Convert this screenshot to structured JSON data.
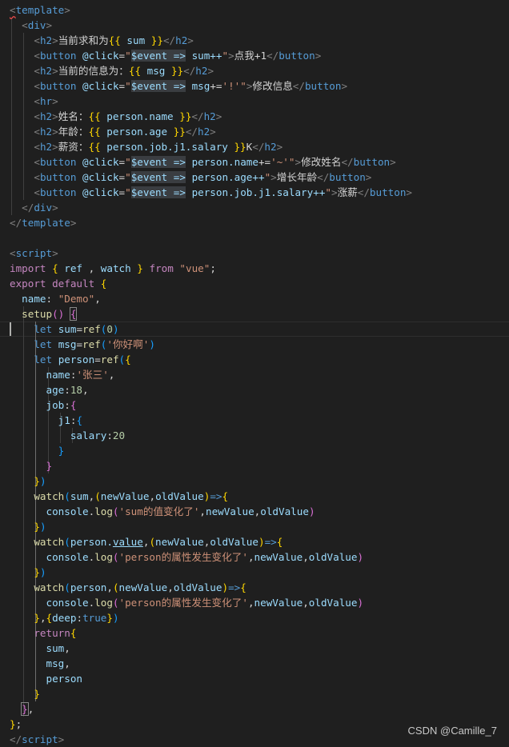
{
  "code_lines": [
    [
      [
        "template-angle",
        "<"
      ],
      [
        "tag",
        "template"
      ],
      [
        "angle",
        ">"
      ]
    ],
    [
      [
        "plain",
        "  "
      ],
      [
        "angle",
        "<"
      ],
      [
        "tag",
        "div"
      ],
      [
        "angle",
        ">"
      ]
    ],
    [
      [
        "plain",
        "    "
      ],
      [
        "angle",
        "<"
      ],
      [
        "tag",
        "h2"
      ],
      [
        "angle",
        ">"
      ],
      [
        "text",
        "当前求和为"
      ],
      [
        "brace",
        "{{"
      ],
      [
        "var",
        " sum "
      ],
      [
        "brace",
        "}}"
      ],
      [
        "angle",
        "</"
      ],
      [
        "tag",
        "h2"
      ],
      [
        "angle",
        ">"
      ]
    ],
    [
      [
        "plain",
        "    "
      ],
      [
        "angle",
        "<"
      ],
      [
        "tag",
        "button"
      ],
      [
        "plain",
        " "
      ],
      [
        "attr",
        "@click"
      ],
      [
        "plain",
        "="
      ],
      [
        "str",
        "\""
      ],
      [
        "hlvar",
        "$event =>"
      ],
      [
        "plain",
        " "
      ],
      [
        "var",
        "sum++"
      ],
      [
        "str",
        "\""
      ],
      [
        "angle",
        ">"
      ],
      [
        "text",
        "点我+1"
      ],
      [
        "angle",
        "</"
      ],
      [
        "tag",
        "button"
      ],
      [
        "angle",
        ">"
      ]
    ],
    [
      [
        "plain",
        "    "
      ],
      [
        "angle",
        "<"
      ],
      [
        "tag",
        "h2"
      ],
      [
        "angle",
        ">"
      ],
      [
        "text",
        "当前的信息为："
      ],
      [
        "brace",
        "{{"
      ],
      [
        "var",
        " msg "
      ],
      [
        "brace",
        "}}"
      ],
      [
        "angle",
        "</"
      ],
      [
        "tag",
        "h2"
      ],
      [
        "angle",
        ">"
      ]
    ],
    [
      [
        "plain",
        "    "
      ],
      [
        "angle",
        "<"
      ],
      [
        "tag",
        "button"
      ],
      [
        "plain",
        " "
      ],
      [
        "attr",
        "@click"
      ],
      [
        "plain",
        "="
      ],
      [
        "str",
        "\""
      ],
      [
        "hlvar",
        "$event =>"
      ],
      [
        "plain",
        " "
      ],
      [
        "var",
        "msg"
      ],
      [
        "plain",
        "+="
      ],
      [
        "str",
        "'!'"
      ],
      [
        "str",
        "\""
      ],
      [
        "angle",
        ">"
      ],
      [
        "text",
        "修改信息"
      ],
      [
        "angle",
        "</"
      ],
      [
        "tag",
        "button"
      ],
      [
        "angle",
        ">"
      ]
    ],
    [
      [
        "plain",
        "    "
      ],
      [
        "angle",
        "<"
      ],
      [
        "tag",
        "hr"
      ],
      [
        "angle",
        ">"
      ]
    ],
    [
      [
        "plain",
        "    "
      ],
      [
        "angle",
        "<"
      ],
      [
        "tag",
        "h2"
      ],
      [
        "angle",
        ">"
      ],
      [
        "text",
        "姓名："
      ],
      [
        "brace",
        "{{"
      ],
      [
        "var",
        " person.name "
      ],
      [
        "brace",
        "}}"
      ],
      [
        "angle",
        "</"
      ],
      [
        "tag",
        "h2"
      ],
      [
        "angle",
        ">"
      ]
    ],
    [
      [
        "plain",
        "    "
      ],
      [
        "angle",
        "<"
      ],
      [
        "tag",
        "h2"
      ],
      [
        "angle",
        ">"
      ],
      [
        "text",
        "年龄："
      ],
      [
        "brace",
        "{{"
      ],
      [
        "var",
        " person.age "
      ],
      [
        "brace",
        "}}"
      ],
      [
        "angle",
        "</"
      ],
      [
        "tag",
        "h2"
      ],
      [
        "angle",
        ">"
      ]
    ],
    [
      [
        "plain",
        "    "
      ],
      [
        "angle",
        "<"
      ],
      [
        "tag",
        "h2"
      ],
      [
        "angle",
        ">"
      ],
      [
        "text",
        "薪资："
      ],
      [
        "brace",
        "{{"
      ],
      [
        "var",
        " person.job.j1.salary "
      ],
      [
        "brace",
        "}}"
      ],
      [
        "text",
        "K"
      ],
      [
        "angle",
        "</"
      ],
      [
        "tag",
        "h2"
      ],
      [
        "angle",
        ">"
      ]
    ],
    [
      [
        "plain",
        "    "
      ],
      [
        "angle",
        "<"
      ],
      [
        "tag",
        "button"
      ],
      [
        "plain",
        " "
      ],
      [
        "attr",
        "@click"
      ],
      [
        "plain",
        "="
      ],
      [
        "str",
        "\""
      ],
      [
        "hlvar",
        "$event =>"
      ],
      [
        "plain",
        " "
      ],
      [
        "var",
        "person.name"
      ],
      [
        "plain",
        "+="
      ],
      [
        "str",
        "'~'"
      ],
      [
        "str",
        "\""
      ],
      [
        "angle",
        ">"
      ],
      [
        "text",
        "修改姓名"
      ],
      [
        "angle",
        "</"
      ],
      [
        "tag",
        "button"
      ],
      [
        "angle",
        ">"
      ]
    ],
    [
      [
        "plain",
        "    "
      ],
      [
        "angle",
        "<"
      ],
      [
        "tag",
        "button"
      ],
      [
        "plain",
        " "
      ],
      [
        "attr",
        "@click"
      ],
      [
        "plain",
        "="
      ],
      [
        "str",
        "\""
      ],
      [
        "hlvar",
        "$event =>"
      ],
      [
        "plain",
        " "
      ],
      [
        "var",
        "person.age++"
      ],
      [
        "str",
        "\""
      ],
      [
        "angle",
        ">"
      ],
      [
        "text",
        "增长年龄"
      ],
      [
        "angle",
        "</"
      ],
      [
        "tag",
        "button"
      ],
      [
        "angle",
        ">"
      ]
    ],
    [
      [
        "plain",
        "    "
      ],
      [
        "angle",
        "<"
      ],
      [
        "tag",
        "button"
      ],
      [
        "plain",
        " "
      ],
      [
        "attr",
        "@click"
      ],
      [
        "plain",
        "="
      ],
      [
        "str",
        "\""
      ],
      [
        "hlvar",
        "$event =>"
      ],
      [
        "plain",
        " "
      ],
      [
        "var",
        "person.job.j1.salary++"
      ],
      [
        "str",
        "\""
      ],
      [
        "angle",
        ">"
      ],
      [
        "text",
        "涨薪"
      ],
      [
        "angle",
        "</"
      ],
      [
        "tag",
        "button"
      ],
      [
        "angle",
        ">"
      ]
    ],
    [
      [
        "plain",
        "  "
      ],
      [
        "angle",
        "</"
      ],
      [
        "tag",
        "div"
      ],
      [
        "angle",
        ">"
      ]
    ],
    [
      [
        "angle",
        "</"
      ],
      [
        "tag",
        "template"
      ],
      [
        "angle",
        ">"
      ]
    ],
    [],
    [
      [
        "angle",
        "<"
      ],
      [
        "tag",
        "script"
      ],
      [
        "angle",
        ">"
      ]
    ],
    [
      [
        "kw",
        "import"
      ],
      [
        "plain",
        " "
      ],
      [
        "b1",
        "{"
      ],
      [
        "var",
        " ref "
      ],
      [
        "plain",
        ", "
      ],
      [
        "var",
        "watch"
      ],
      [
        "plain",
        " "
      ],
      [
        "b1",
        "}"
      ],
      [
        "plain",
        " "
      ],
      [
        "kw",
        "from"
      ],
      [
        "plain",
        " "
      ],
      [
        "str",
        "\"vue\""
      ],
      [
        "plain",
        ";"
      ]
    ],
    [
      [
        "kw",
        "export"
      ],
      [
        "plain",
        " "
      ],
      [
        "kw",
        "default"
      ],
      [
        "plain",
        " "
      ],
      [
        "b1",
        "{"
      ]
    ],
    [
      [
        "plain",
        "  "
      ],
      [
        "var",
        "name"
      ],
      [
        "plain",
        ": "
      ],
      [
        "str",
        "\"Demo\""
      ],
      [
        "plain",
        ","
      ]
    ],
    [
      [
        "plain",
        "  "
      ],
      [
        "fn",
        "setup"
      ],
      [
        "b2",
        "()"
      ],
      [
        "plain",
        " "
      ],
      [
        "b2box",
        "{"
      ]
    ],
    [
      [
        "plain",
        "    "
      ],
      [
        "kw2",
        "let"
      ],
      [
        "plain",
        " "
      ],
      [
        "var",
        "sum"
      ],
      [
        "plain",
        "="
      ],
      [
        "fn",
        "ref"
      ],
      [
        "b3",
        "("
      ],
      [
        "num",
        "0"
      ],
      [
        "b3",
        ")"
      ]
    ],
    [
      [
        "plain",
        "    "
      ],
      [
        "kw2",
        "let"
      ],
      [
        "plain",
        " "
      ],
      [
        "var",
        "msg"
      ],
      [
        "plain",
        "="
      ],
      [
        "fn",
        "ref"
      ],
      [
        "b3",
        "("
      ],
      [
        "str",
        "'你好啊'"
      ],
      [
        "b3",
        ")"
      ]
    ],
    [
      [
        "plain",
        "    "
      ],
      [
        "kw2",
        "let"
      ],
      [
        "plain",
        " "
      ],
      [
        "var",
        "person"
      ],
      [
        "plain",
        "="
      ],
      [
        "fn",
        "ref"
      ],
      [
        "b3",
        "("
      ],
      [
        "b1",
        "{"
      ]
    ],
    [
      [
        "plain",
        "      "
      ],
      [
        "var",
        "name"
      ],
      [
        "plain",
        ":"
      ],
      [
        "str",
        "'张三'"
      ],
      [
        "plain",
        ","
      ]
    ],
    [
      [
        "plain",
        "      "
      ],
      [
        "var",
        "age"
      ],
      [
        "plain",
        ":"
      ],
      [
        "num",
        "18"
      ],
      [
        "plain",
        ","
      ]
    ],
    [
      [
        "plain",
        "      "
      ],
      [
        "var",
        "job"
      ],
      [
        "plain",
        ":"
      ],
      [
        "b2",
        "{"
      ]
    ],
    [
      [
        "plain",
        "        "
      ],
      [
        "var",
        "j1"
      ],
      [
        "plain",
        ":"
      ],
      [
        "b3",
        "{"
      ]
    ],
    [
      [
        "plain",
        "          "
      ],
      [
        "var",
        "salary"
      ],
      [
        "plain",
        ":"
      ],
      [
        "num",
        "20"
      ]
    ],
    [
      [
        "plain",
        "        "
      ],
      [
        "b3",
        "}"
      ]
    ],
    [
      [
        "plain",
        "      "
      ],
      [
        "b2",
        "}"
      ]
    ],
    [
      [
        "plain",
        "    "
      ],
      [
        "b1",
        "}"
      ],
      [
        "b3",
        ")"
      ]
    ],
    [
      [
        "plain",
        "    "
      ],
      [
        "fn",
        "watch"
      ],
      [
        "b3",
        "("
      ],
      [
        "var",
        "sum"
      ],
      [
        "plain",
        ","
      ],
      [
        "b1",
        "("
      ],
      [
        "var",
        "newValue"
      ],
      [
        "plain",
        ","
      ],
      [
        "var",
        "oldValue"
      ],
      [
        "b1",
        ")"
      ],
      [
        "kw2",
        "=>"
      ],
      [
        "b1",
        "{"
      ]
    ],
    [
      [
        "plain",
        "      "
      ],
      [
        "var",
        "console"
      ],
      [
        "plain",
        "."
      ],
      [
        "fn",
        "log"
      ],
      [
        "b2",
        "("
      ],
      [
        "str",
        "'sum的值变化了'"
      ],
      [
        "plain",
        ","
      ],
      [
        "var",
        "newValue"
      ],
      [
        "plain",
        ","
      ],
      [
        "var",
        "oldValue"
      ],
      [
        "b2",
        ")"
      ]
    ],
    [
      [
        "plain",
        "    "
      ],
      [
        "b1",
        "}"
      ],
      [
        "b3",
        ")"
      ]
    ],
    [
      [
        "plain",
        "    "
      ],
      [
        "fn",
        "watch"
      ],
      [
        "b3",
        "("
      ],
      [
        "var",
        "person."
      ],
      [
        "ulvar",
        "value"
      ],
      [
        "plain",
        ","
      ],
      [
        "b1",
        "("
      ],
      [
        "var",
        "newValue"
      ],
      [
        "plain",
        ","
      ],
      [
        "var",
        "oldValue"
      ],
      [
        "b1",
        ")"
      ],
      [
        "kw2",
        "=>"
      ],
      [
        "b1",
        "{"
      ]
    ],
    [
      [
        "plain",
        "      "
      ],
      [
        "var",
        "console"
      ],
      [
        "plain",
        "."
      ],
      [
        "fn",
        "log"
      ],
      [
        "b2",
        "("
      ],
      [
        "str",
        "'person的属性发生变化了'"
      ],
      [
        "plain",
        ","
      ],
      [
        "var",
        "newValue"
      ],
      [
        "plain",
        ","
      ],
      [
        "var",
        "oldValue"
      ],
      [
        "b2",
        ")"
      ]
    ],
    [
      [
        "plain",
        "    "
      ],
      [
        "b1",
        "}"
      ],
      [
        "b3",
        ")"
      ]
    ],
    [
      [
        "plain",
        "    "
      ],
      [
        "fn",
        "watch"
      ],
      [
        "b3",
        "("
      ],
      [
        "var",
        "person"
      ],
      [
        "plain",
        ","
      ],
      [
        "b1",
        "("
      ],
      [
        "var",
        "newValue"
      ],
      [
        "plain",
        ","
      ],
      [
        "var",
        "oldValue"
      ],
      [
        "b1",
        ")"
      ],
      [
        "kw2",
        "=>"
      ],
      [
        "b1",
        "{"
      ]
    ],
    [
      [
        "plain",
        "      "
      ],
      [
        "var",
        "console"
      ],
      [
        "plain",
        "."
      ],
      [
        "fn",
        "log"
      ],
      [
        "b2",
        "("
      ],
      [
        "str",
        "'person的属性发生变化了'"
      ],
      [
        "plain",
        ","
      ],
      [
        "var",
        "newValue"
      ],
      [
        "plain",
        ","
      ],
      [
        "var",
        "oldValue"
      ],
      [
        "b2",
        ")"
      ]
    ],
    [
      [
        "plain",
        "    "
      ],
      [
        "b1",
        "}"
      ],
      [
        "plain",
        ","
      ],
      [
        "b1",
        "{"
      ],
      [
        "var",
        "deep"
      ],
      [
        "plain",
        ":"
      ],
      [
        "kw2",
        "true"
      ],
      [
        "b1",
        "}"
      ],
      [
        "b3",
        ")"
      ]
    ],
    [
      [
        "plain",
        "    "
      ],
      [
        "kw",
        "return"
      ],
      [
        "b1",
        "{"
      ]
    ],
    [
      [
        "plain",
        "      "
      ],
      [
        "var",
        "sum"
      ],
      [
        "plain",
        ","
      ]
    ],
    [
      [
        "plain",
        "      "
      ],
      [
        "var",
        "msg"
      ],
      [
        "plain",
        ","
      ]
    ],
    [
      [
        "plain",
        "      "
      ],
      [
        "var",
        "person"
      ]
    ],
    [
      [
        "plain",
        "    "
      ],
      [
        "b1",
        "}"
      ]
    ],
    [
      [
        "plain",
        "  "
      ],
      [
        "b2box",
        "}"
      ],
      [
        "plain",
        ","
      ]
    ],
    [
      [
        "b1",
        "}"
      ],
      [
        "plain",
        ";"
      ]
    ],
    [
      [
        "angle",
        "</"
      ],
      [
        "tag",
        "script"
      ],
      [
        "angle",
        ">"
      ]
    ]
  ],
  "token_colors": {
    "plain": "#d4d4d4",
    "angle": "#808080",
    "template-angle": "#808080",
    "tag": "#569cd6",
    "text": "#d4d4d4",
    "brace": "#ffd700",
    "var": "#9cdcfe",
    "hlvar": "#9cdcfe",
    "ulvar": "#9cdcfe",
    "attr": "#9cdcfe",
    "str": "#ce9178",
    "kw": "#c586c0",
    "kw2": "#569cd6",
    "fn": "#dcdcaa",
    "num": "#b5cea8",
    "b1": "#ffd700",
    "b2": "#da70d6",
    "b2box": "#da70d6",
    "b3": "#179fff"
  },
  "watermark": "CSDN @Camille_7"
}
